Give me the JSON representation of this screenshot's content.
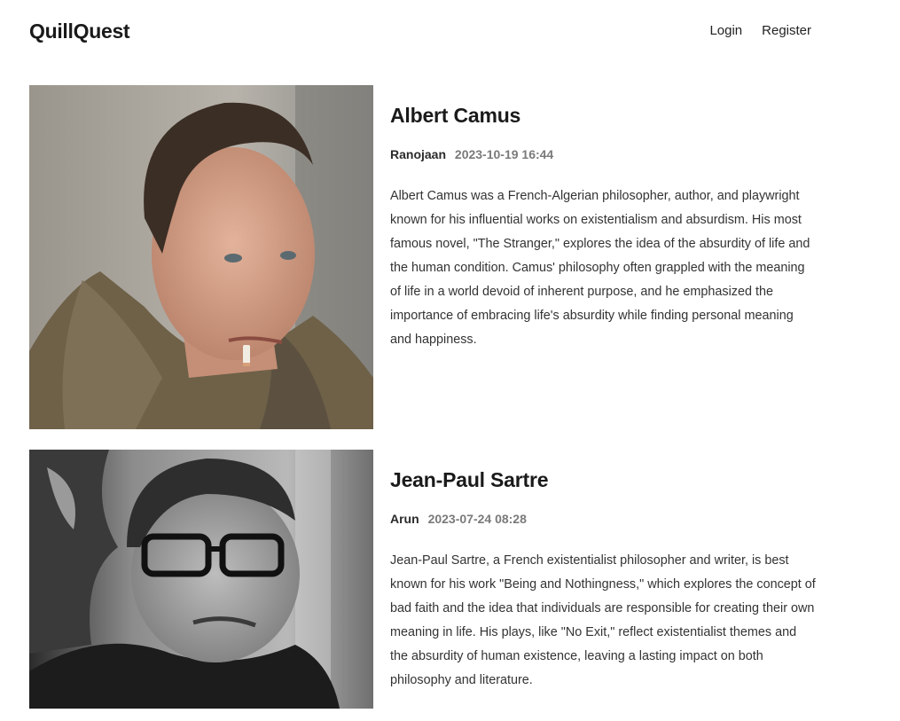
{
  "header": {
    "logo": "QuillQuest",
    "nav": {
      "login": "Login",
      "register": "Register"
    }
  },
  "posts": [
    {
      "title": "Albert Camus",
      "author": "Ranojaan",
      "date": "2023-10-19 16:44",
      "excerpt": "Albert Camus was a French-Algerian philosopher, author, and playwright known for his influential works on existentialism and absurdism. His most famous novel, \"The Stranger,\" explores the idea of the absurdity of life and the human condition. Camus' philosophy often grappled with the meaning of life in a world devoid of inherent purpose, and he emphasized the importance of embracing life's absurdity while finding personal meaning and happiness."
    },
    {
      "title": "Jean-Paul Sartre",
      "author": "Arun",
      "date": "2023-07-24 08:28",
      "excerpt": "Jean-Paul Sartre, a French existentialist philosopher and writer, is best known for his work \"Being and Nothingness,\" which explores the concept of bad faith and the idea that individuals are responsible for creating their own meaning in life. His plays, like \"No Exit,\" reflect existentialist themes and the absurdity of human existence, leaving a lasting impact on both philosophy and literature."
    }
  ]
}
